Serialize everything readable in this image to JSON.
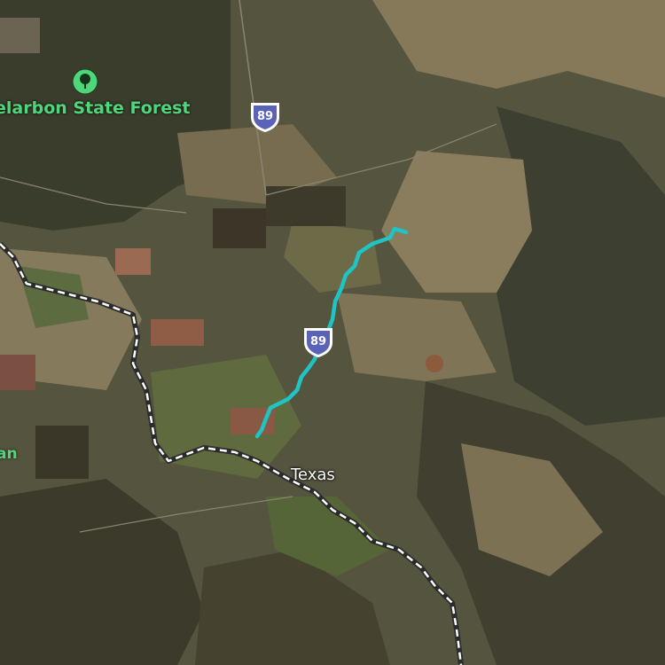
{
  "map": {
    "poi": {
      "label": "elarbon State Forest",
      "icon": "tree-icon",
      "color": "#4fd67a"
    },
    "edge_label": "an",
    "city": {
      "label": "Texas"
    },
    "highway_shields": [
      {
        "number": "89"
      },
      {
        "number": "89"
      }
    ],
    "colors": {
      "route": "#1fc4c4",
      "border_dash": "#ffffff",
      "border_casing": "#2b2b2b",
      "shield_fill": "#5b63b8"
    }
  }
}
